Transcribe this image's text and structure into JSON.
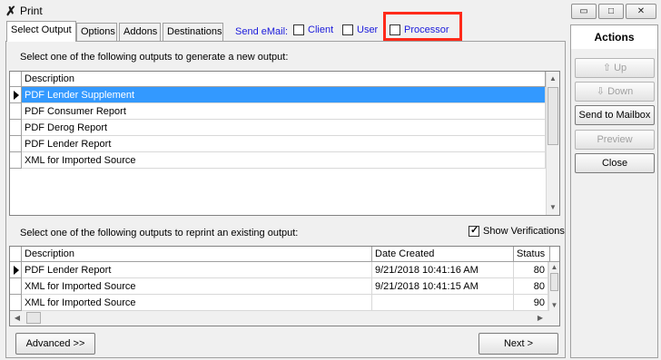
{
  "window": {
    "title": "Print",
    "min_glyph": "▭",
    "max_glyph": "□",
    "close_glyph": "✕"
  },
  "tabs": [
    {
      "label": "Select Output",
      "active": true
    },
    {
      "label": "Options"
    },
    {
      "label": "Addons"
    },
    {
      "label": "Destinations"
    }
  ],
  "send_email": {
    "label": "Send eMail:",
    "options": [
      {
        "label": "Client",
        "checked": false
      },
      {
        "label": "User",
        "checked": false
      },
      {
        "label": "Processor",
        "checked": false
      }
    ]
  },
  "new_output": {
    "prompt": "Select one of the following outputs to generate a new output:",
    "column": "Description",
    "rows": [
      "PDF Lender Supplement",
      "PDF Consumer Report",
      "PDF Derog Report",
      "PDF Lender Report",
      "XML for Imported Source"
    ],
    "selected_index": 0
  },
  "reprint": {
    "prompt": "Select one of the following outputs to reprint an existing output:",
    "show_verifications_label": "Show Verifications",
    "show_verifications_checked": true,
    "columns": [
      "Description",
      "Date Created",
      "Status"
    ],
    "rows": [
      {
        "description": "PDF Lender Report",
        "date": "9/21/2018 10:41:16 AM",
        "status": "80"
      },
      {
        "description": "XML for Imported Source",
        "date": "9/21/2018 10:41:15 AM",
        "status": "80"
      },
      {
        "description": "XML for Imported Source",
        "date": "",
        "status": "90"
      }
    ]
  },
  "footer": {
    "advanced_label": "Advanced >>",
    "next_label": "Next  >"
  },
  "actions": {
    "title": "Actions",
    "up_label": "Up",
    "down_label": "Down",
    "send_mailbox_label": "Send to Mailbox",
    "preview_label": "Preview",
    "close_label": "Close"
  }
}
